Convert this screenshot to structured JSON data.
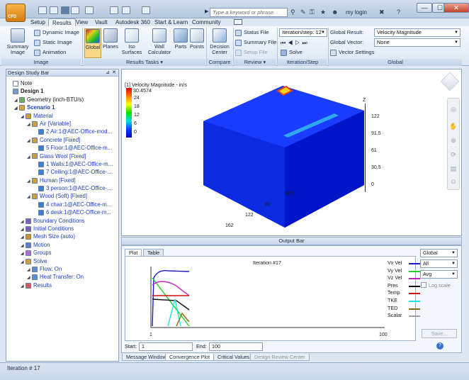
{
  "titlebar": {
    "app_menu_label": "CFD",
    "search_placeholder": "Type a keyword or phrase",
    "login": "my login",
    "win_min": "—",
    "win_max": "☐",
    "win_close": "✕"
  },
  "tabs": [
    "Setup",
    "Results",
    "View",
    "Vault",
    "Autodesk 360",
    "Start & Learn",
    "Community"
  ],
  "ribbon": {
    "image_group": {
      "label": "Image",
      "summary_image": "Summary Image",
      "dynamic_image": "Dynamic Image",
      "static_image": "Static Image",
      "animation": "Animation"
    },
    "results_tasks": {
      "label": "Results Tasks",
      "buttons": [
        "Global",
        "Planes",
        "Iso Surfaces",
        "Wall Calculator",
        "Parts",
        "Points"
      ]
    },
    "compare": {
      "label": "Compare",
      "decision_center": "Decision Center"
    },
    "review": {
      "label": "Review",
      "status_file": "Status File",
      "summary_file": "Summary File",
      "setup_file": "Setup File"
    },
    "iteration": {
      "label": "Iteration/Step",
      "select": "Iteration/step: 12",
      "solve": "Solve"
    },
    "global": {
      "label": "Global",
      "result_label": "Global Result:",
      "result_value": "Velocity Magnitude",
      "vector_label": "Global Vector:",
      "vector_value": "None",
      "vector_settings": "Vector Settings"
    }
  },
  "left_panel": {
    "title": "Design Study Bar",
    "items": [
      {
        "text": "Note",
        "indent": 0,
        "style": "",
        "icon": "note-icon",
        "color": "#ffffff"
      },
      {
        "text": "Design 1",
        "indent": 0,
        "style": "bold",
        "icon": "design-icon",
        "color": "#7a9ccc"
      },
      {
        "text": "Geometry (inch-BTU/s)",
        "indent": 1,
        "style": "",
        "icon": "geometry-icon",
        "color": "#6fae5a"
      },
      {
        "text": "Scenario 1",
        "indent": 1,
        "style": "blue bold",
        "icon": "scenario-icon",
        "color": "#e0a03a"
      },
      {
        "text": "Material",
        "indent": 2,
        "style": "blue",
        "icon": "material-icon",
        "color": "#c9a13a"
      },
      {
        "text": "Air [Variable]",
        "indent": 3,
        "style": "blue",
        "icon": "material-icon",
        "color": "#c9a13a"
      },
      {
        "text": "2 Air:1@AEC-Office-mod...",
        "indent": 4,
        "style": "blue",
        "icon": "part-icon",
        "color": "#3a7fd0"
      },
      {
        "text": "Concrete [Fixed]",
        "indent": 3,
        "style": "blue",
        "icon": "material-icon",
        "color": "#c9a13a"
      },
      {
        "text": "5 Floor:1@AEC-Office-m...",
        "indent": 4,
        "style": "blue",
        "icon": "part-icon",
        "color": "#3a7fd0"
      },
      {
        "text": "Glass Wool [Fixed]",
        "indent": 3,
        "style": "blue",
        "icon": "material-icon",
        "color": "#c9a13a"
      },
      {
        "text": "1 Walls:1@AEC-Office-m...",
        "indent": 4,
        "style": "blue",
        "icon": "part-icon",
        "color": "#3a7fd0"
      },
      {
        "text": "7 Ceiling:1@AEC-Office-...",
        "indent": 4,
        "style": "blue",
        "icon": "part-icon",
        "color": "#3a7fd0"
      },
      {
        "text": "Human [Fixed]",
        "indent": 3,
        "style": "blue",
        "icon": "material-icon",
        "color": "#c9a13a"
      },
      {
        "text": "3 person:1@AEC-Office-...",
        "indent": 4,
        "style": "blue",
        "icon": "part-icon",
        "color": "#3a7fd0"
      },
      {
        "text": "Wood (Soft) [Fixed]",
        "indent": 3,
        "style": "blue",
        "icon": "material-icon",
        "color": "#c9a13a"
      },
      {
        "text": "4 chair:1@AEC-Office-m...",
        "indent": 4,
        "style": "blue",
        "icon": "part-icon",
        "color": "#3a7fd0"
      },
      {
        "text": "6 desk:1@AEC-Office-m...",
        "indent": 4,
        "style": "blue",
        "icon": "part-icon",
        "color": "#3a7fd0"
      },
      {
        "text": "Boundary Conditions",
        "indent": 2,
        "style": "blue",
        "icon": "bc-icon",
        "color": "#7e5fbf"
      },
      {
        "text": "Initial Conditions",
        "indent": 2,
        "style": "blue",
        "icon": "ic-icon",
        "color": "#7e5fbf"
      },
      {
        "text": "Mesh Size (auto)",
        "indent": 2,
        "style": "blue",
        "icon": "mesh-icon",
        "color": "#d09030"
      },
      {
        "text": "Motion",
        "indent": 2,
        "style": "blue",
        "icon": "motion-icon",
        "color": "#5a7fd0"
      },
      {
        "text": "Groups",
        "indent": 2,
        "style": "blue",
        "icon": "groups-icon",
        "color": "#b06fd0"
      },
      {
        "text": "Solve",
        "indent": 2,
        "style": "blue",
        "icon": "solve-icon",
        "color": "#d0a040"
      },
      {
        "text": "Flow: On",
        "indent": 3,
        "style": "blue",
        "icon": "flow-icon",
        "color": "#5a8fd0"
      },
      {
        "text": "Heat Transfer: On",
        "indent": 3,
        "style": "blue",
        "icon": "heat-icon",
        "color": "#5a8fd0"
      },
      {
        "text": "Results",
        "indent": 2,
        "style": "blue",
        "icon": "results-icon",
        "color": "#d05a5a"
      }
    ]
  },
  "viewport": {
    "legend_title": "[1] Velocity Magnitude - in/s",
    "legend_max": "30.4574",
    "legend_ticks": [
      "24",
      "18",
      "12",
      "6",
      "0"
    ],
    "axis_z_label": "Z",
    "z_ticks": [
      "122",
      "91.5",
      "61",
      "30.5",
      "0"
    ],
    "x_ticks": [
      "40.5",
      "81",
      "122",
      "162"
    ]
  },
  "output": {
    "title": "Output Bar",
    "plot_tab": "Plot",
    "table_tab": "Table",
    "chart_title": "Iteration #17",
    "start_label": "Start:",
    "start_value": "1",
    "end_label": "End:",
    "end_value": "100",
    "dropdowns": [
      "Global",
      "All",
      "Avg"
    ],
    "log_scale": "Log scale",
    "save": "Save...",
    "bottom_tabs": [
      "Message Window",
      "Convergence Plot",
      "Critical Values",
      "Design Review Center"
    ]
  },
  "chart_data": {
    "type": "line",
    "title": "Iteration #17",
    "xlim": [
      1,
      100
    ],
    "x_tick_labels": [
      "1",
      "100"
    ],
    "series": [
      {
        "name": "Vx Vel",
        "color": "#1a1acc"
      },
      {
        "name": "Vy Vel",
        "color": "#20d020"
      },
      {
        "name": "Vz Vel",
        "color": "#c020c0"
      },
      {
        "name": "Pres",
        "color": "#101010"
      },
      {
        "name": "Temp",
        "color": "#d01010"
      },
      {
        "name": "TKE",
        "color": "#20e0e0"
      },
      {
        "name": "TED",
        "color": "#8a6a10"
      },
      {
        "name": "Scalar",
        "color": "#a0a0a0"
      }
    ]
  },
  "status": {
    "text": "Iteration # 17"
  }
}
